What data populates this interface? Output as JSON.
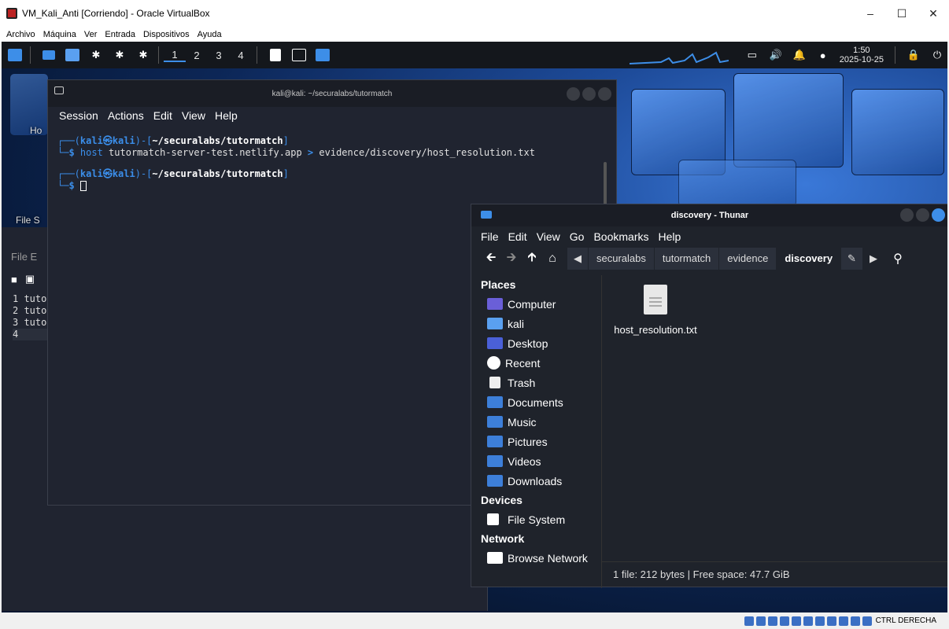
{
  "vbox": {
    "title": "VM_Kali_Anti [Corriendo] - Oracle VirtualBox",
    "menu": [
      "Archivo",
      "Máquina",
      "Ver",
      "Entrada",
      "Dispositivos",
      "Ayuda"
    ],
    "host_key": "CTRL DERECHA"
  },
  "panel": {
    "workspaces": [
      "1",
      "2",
      "3",
      "4"
    ],
    "time": "1:50",
    "date": "2025-10-25"
  },
  "desktop": {
    "icons": [
      "Ho",
      "File S"
    ]
  },
  "terminal": {
    "title": "kali@kali: ~/securalabs/tutormatch",
    "menu": [
      "Session",
      "Actions",
      "Edit",
      "View",
      "Help"
    ],
    "prompt_user": "kali",
    "prompt_host": "kali",
    "prompt_path": "~/securalabs/tutormatch",
    "command": "host",
    "command_arg1": "tutormatch-server-test.netlify.app",
    "redirect": ">",
    "command_arg2": "evidence/discovery/host_resolution.txt"
  },
  "editor": {
    "menu_partial": "File  E",
    "lines": [
      "1 tuto",
      "2 tuto",
      "3 tuto",
      "4"
    ]
  },
  "thunar": {
    "title": "discovery - Thunar",
    "menu": [
      "File",
      "Edit",
      "View",
      "Go",
      "Bookmarks",
      "Help"
    ],
    "breadcrumbs": [
      "securalabs",
      "tutormatch",
      "evidence",
      "discovery"
    ],
    "places_header": "Places",
    "places": [
      {
        "label": "Computer",
        "icon": "computer-icon"
      },
      {
        "label": "kali",
        "icon": "home-folder-icon"
      },
      {
        "label": "Desktop",
        "icon": "desktop-icon"
      },
      {
        "label": "Recent",
        "icon": "recent-icon"
      },
      {
        "label": "Trash",
        "icon": "trash-icon"
      },
      {
        "label": "Documents",
        "icon": "documents-folder-icon"
      },
      {
        "label": "Music",
        "icon": "music-folder-icon"
      },
      {
        "label": "Pictures",
        "icon": "pictures-folder-icon"
      },
      {
        "label": "Videos",
        "icon": "videos-folder-icon"
      },
      {
        "label": "Downloads",
        "icon": "downloads-folder-icon"
      }
    ],
    "devices_header": "Devices",
    "devices": [
      {
        "label": "File System",
        "icon": "drive-icon"
      }
    ],
    "network_header": "Network",
    "network": [
      {
        "label": "Browse Network",
        "icon": "network-icon"
      }
    ],
    "file_name": "host_resolution.txt",
    "status": "1 file: 212 bytes  |  Free space: 47.7 GiB"
  }
}
